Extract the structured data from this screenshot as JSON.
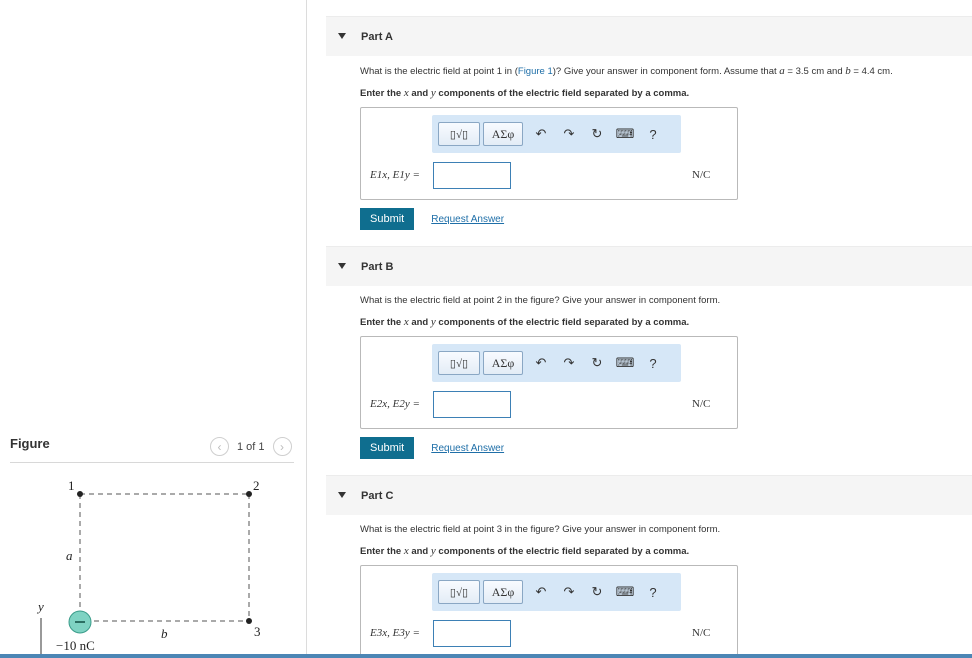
{
  "figure_panel": {
    "title": "Figure",
    "pager": {
      "text": "1 of 1"
    },
    "labels": {
      "point1": "1",
      "point2": "2",
      "point3": "3",
      "a": "a",
      "b": "b",
      "y": "y",
      "charge": "−10 nC"
    }
  },
  "parts": [
    {
      "title": "Part A",
      "question": {
        "pre": "What is the electric field at point 1 in (",
        "link": "Figure 1",
        "post": ")? Give your answer in component form. Assume that ",
        "a_var": "a",
        "a_val": " = 3.5 cm",
        "and": " and ",
        "b_var": "b",
        "b_val": " = 4.4 cm."
      },
      "instruction": {
        "pre": "Enter the ",
        "x": "x",
        "mid": " and ",
        "y": "y",
        "post": " components of the electric field separated by a comma."
      },
      "answer_label": "E1x, E1y =",
      "unit": "N/C",
      "submit": "Submit",
      "request": "Request Answer"
    },
    {
      "title": "Part B",
      "question": {
        "text": "What is the electric field at point 2 in the figure? Give your answer in component form."
      },
      "instruction": {
        "pre": "Enter the ",
        "x": "x",
        "mid": " and ",
        "y": "y",
        "post": " components of the electric field separated by a comma."
      },
      "answer_label": "E2x, E2y =",
      "unit": "N/C",
      "submit": "Submit",
      "request": "Request Answer"
    },
    {
      "title": "Part C",
      "question": {
        "text": "What is the electric field at point 3 in the figure? Give your answer in component form."
      },
      "instruction": {
        "pre": "Enter the ",
        "x": "x",
        "mid": " and ",
        "y": "y",
        "post": " components of the electric field separated by a comma."
      },
      "answer_label": "E3x, E3y =",
      "unit": "N/C"
    }
  ],
  "toolbar": {
    "templates": "▯√▯",
    "greek": "ΑΣφ",
    "help": "?"
  },
  "colors": {
    "link": "#1f6fa8",
    "submit_bg": "#0f6e8f",
    "toolbar_bg": "#d6e7f7",
    "charge_fill": "#7fd3c3"
  }
}
